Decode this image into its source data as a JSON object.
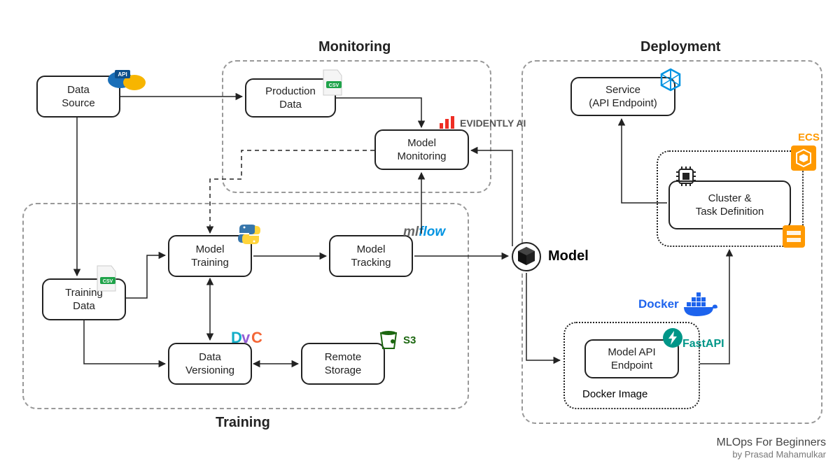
{
  "sections": {
    "monitoring": "Monitoring",
    "training": "Training",
    "deployment": "Deployment"
  },
  "nodes": {
    "dataSource": "Data\nSource",
    "productionData": "Production\nData",
    "modelMonitoring": "Model\nMonitoring",
    "trainingData": "Training\nData",
    "modelTraining": "Model\nTraining",
    "modelTracking": "Model\nTracking",
    "dataVersioning": "Data\nVersioning",
    "remoteStorage": "Remote\nStorage",
    "service": "Service\n(API Endpoint)",
    "clusterTask": "Cluster &\nTask Definition",
    "modelApiEndpoint": "Model API\nEndpoint",
    "dockerImage": "Docker Image"
  },
  "labels": {
    "model": "Model",
    "evidently": "EVIDENTLY AI",
    "mlflow": "mlflow",
    "s3": "S3",
    "docker": "Docker",
    "fastapi": "FastAPI",
    "ecs": "ECS"
  },
  "footer": {
    "title": "MLOps For Beginners",
    "author": "by Prasad Mahamulkar"
  },
  "colors": {
    "evidently": "#ee2e24",
    "mlflow": "#0194e2",
    "s3": "#1b660f",
    "docker": "#1d63ed",
    "fastapi": "#009688",
    "ecs": "#ff9900"
  },
  "icons": {
    "api": "api-cloud-icon",
    "csv": "csv-file-icon",
    "python": "python-icon",
    "dvc": "dvc-icon",
    "s3bucket": "s3-bucket-icon",
    "cube": "cube-icon",
    "hexagon": "hexagon-icon",
    "chip": "chip-icon",
    "awsOrange": "aws-orange-icon",
    "dockerWhale": "docker-whale-icon",
    "fastapiBolt": "fastapi-bolt-icon",
    "evidentlyBars": "evidently-bars-icon"
  }
}
